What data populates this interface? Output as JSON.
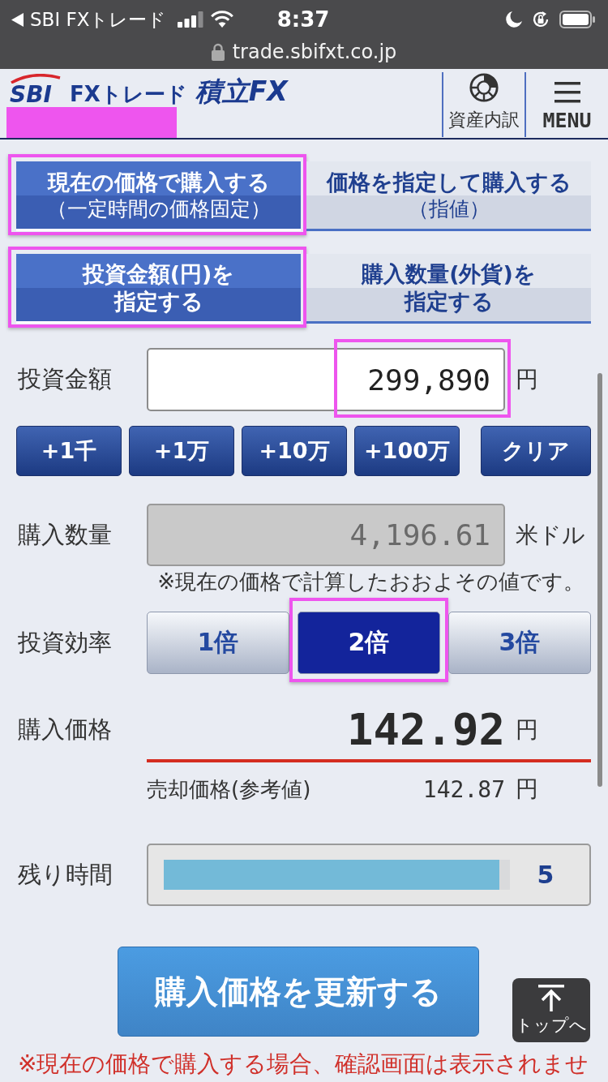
{
  "status_bar": {
    "back_label": "SBI FXトレード",
    "time": "8:37",
    "url": "trade.sbifxt.co.jp"
  },
  "header": {
    "logo": {
      "brand": "SBI",
      "service": "FXトレード",
      "product": "積立FX"
    },
    "account_hidden": true,
    "nav": [
      {
        "kind": "assets",
        "label": "資産内訳"
      },
      {
        "kind": "menu",
        "label": "MENU"
      }
    ]
  },
  "order_type_tabs": [
    {
      "label": "現在の価格で購入する",
      "sub": "（一定時間の価格固定）",
      "selected": true,
      "highlighted": true
    },
    {
      "label": "価格を指定して購入する",
      "sub": "（指値）",
      "selected": false,
      "highlighted": false
    }
  ],
  "amount_mode_tabs": [
    {
      "lines": [
        "投資金額(円)を",
        "指定する"
      ],
      "selected": true,
      "highlighted": true
    },
    {
      "lines": [
        "購入数量(外貨)を",
        "指定する"
      ],
      "selected": false,
      "highlighted": false
    }
  ],
  "investment_amount": {
    "label": "投資金額",
    "value": "299,890",
    "unit": "円",
    "highlighted": true
  },
  "quick_buttons": [
    {
      "kind": "add",
      "label": "+1千"
    },
    {
      "kind": "add",
      "label": "+1万"
    },
    {
      "kind": "add",
      "label": "+10万"
    },
    {
      "kind": "add",
      "label": "+100万"
    },
    {
      "kind": "clear",
      "label": "クリア"
    }
  ],
  "quantity": {
    "label": "購入数量",
    "value": "4,196.61",
    "unit": "米ドル",
    "disabled": true,
    "note": "※現在の価格で計算したおおよその値です。"
  },
  "leverage": {
    "label": "投資効率",
    "options": [
      {
        "label": "1倍",
        "selected": false,
        "highlighted": false
      },
      {
        "label": "2倍",
        "selected": true,
        "highlighted": true
      },
      {
        "label": "3倍",
        "selected": false,
        "highlighted": false
      }
    ]
  },
  "buy_price": {
    "label": "購入価格",
    "value": "142.92",
    "unit": "円"
  },
  "sell_price": {
    "label": "売却価格(参考値)",
    "value": "142.87",
    "unit": "円"
  },
  "remaining_time": {
    "label": "残り時間",
    "level": 0.97,
    "value": "5"
  },
  "update_button": "購入価格を更新する",
  "back_to_top": "トップへ",
  "footer_note": "※現在の価格で購入する場合、確認画面は表示されませ"
}
